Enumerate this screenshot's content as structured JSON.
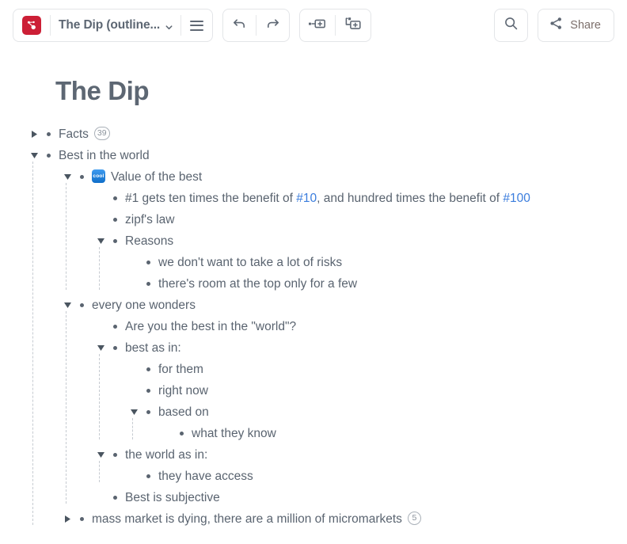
{
  "toolbar": {
    "logo_icon": "mindmeister-logo-icon",
    "document_title": "The Dip (outline...",
    "dropdown_icon": "chevron-down-icon",
    "menu_icon": "hamburger-menu-icon",
    "undo_icon": "undo-arrow-icon",
    "redo_icon": "redo-arrow-icon",
    "add_sibling_icon": "add-sibling-node-icon",
    "add_child_icon": "add-child-node-icon",
    "search_icon": "search-icon",
    "share_icon": "share-icon",
    "share_label": "Share"
  },
  "page": {
    "title": "The Dip"
  },
  "colors": {
    "brand_red": "#cc1f36",
    "link_blue": "#3b7ddd",
    "text_gray": "#5a6470",
    "badge_blue": "#1478d4"
  },
  "outline": [
    {
      "id": "facts",
      "level": 0,
      "toggle": "collapsed",
      "text": "Facts",
      "count": "39"
    },
    {
      "id": "best-in-the-world",
      "level": 0,
      "toggle": "expanded",
      "text": "Best in the world"
    },
    {
      "id": "value-of-the-best",
      "level": 1,
      "toggle": "expanded",
      "icon": "cool-badge-icon",
      "icon_text": "cool",
      "text": "Value of the best"
    },
    {
      "id": "number-one-benefit",
      "level": 2,
      "toggle": "none",
      "segments": [
        {
          "type": "text",
          "value": "#1 gets ten times the benefit of "
        },
        {
          "type": "link",
          "value": "#10"
        },
        {
          "type": "text",
          "value": ", and hundred times the benefit of "
        },
        {
          "type": "link",
          "value": "#100"
        }
      ]
    },
    {
      "id": "zipfs-law",
      "level": 2,
      "toggle": "none",
      "text": "zipf's law"
    },
    {
      "id": "reasons",
      "level": 2,
      "toggle": "expanded",
      "text": "Reasons"
    },
    {
      "id": "avoid-risks",
      "level": 3,
      "toggle": "none",
      "text": "we don't want to take a lot of risks"
    },
    {
      "id": "room-at-the-top",
      "level": 3,
      "toggle": "none",
      "text": "there's room at the top only for a few"
    },
    {
      "id": "every-one-wonders",
      "level": 1,
      "toggle": "expanded",
      "text": "every one wonders"
    },
    {
      "id": "are-you-the-best",
      "level": 2,
      "toggle": "none",
      "text": "Are you the best in the \"world\"?"
    },
    {
      "id": "best-as-in",
      "level": 2,
      "toggle": "expanded",
      "text": "best as in:"
    },
    {
      "id": "for-them",
      "level": 3,
      "toggle": "none",
      "text": "for them"
    },
    {
      "id": "right-now",
      "level": 3,
      "toggle": "none",
      "text": "right now"
    },
    {
      "id": "based-on",
      "level": 3,
      "toggle": "expanded",
      "text": "based on"
    },
    {
      "id": "what-they-know",
      "level": 4,
      "toggle": "none",
      "text": "what they know"
    },
    {
      "id": "the-world-as-in",
      "level": 2,
      "toggle": "expanded",
      "text": "the world as in:"
    },
    {
      "id": "they-have-access",
      "level": 3,
      "toggle": "none",
      "text": "they have access"
    },
    {
      "id": "best-is-subjective",
      "level": 2,
      "toggle": "none",
      "text": "Best is subjective"
    },
    {
      "id": "mass-market-is-dying",
      "level": 1,
      "toggle": "collapsed",
      "text": "mass market is dying, there are a million of micromarkets",
      "count": "5"
    }
  ]
}
